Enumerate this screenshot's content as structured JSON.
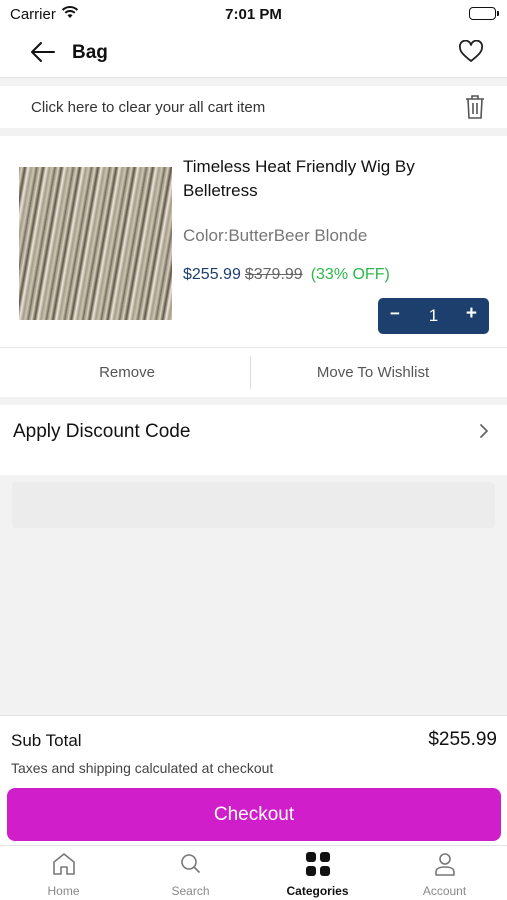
{
  "status_bar": {
    "carrier": "Carrier",
    "time": "7:01 PM"
  },
  "nav": {
    "title": "Bag",
    "back_icon": "arrow-left-icon",
    "wishlist_icon": "heart-icon"
  },
  "clear_cart": {
    "text": "Click here to clear your all cart item",
    "icon": "trash-icon"
  },
  "cart_item": {
    "name": "Timeless Heat Friendly Wig By Belletress",
    "color": "Color:ButterBeer Blonde",
    "price": "$255.99",
    "old_price": "$379.99",
    "discount": "(33% OFF)",
    "quantity": "1",
    "minus_label": "−",
    "plus_label": "+",
    "remove_label": "Remove",
    "wishlist_label": "Move To Wishlist"
  },
  "discount_code": {
    "label": "Apply Discount Code"
  },
  "summary": {
    "subtotal_label": "Sub Total",
    "subtotal_value": "$255.99",
    "tax_note": "Taxes and shipping calculated at checkout",
    "checkout_label": "Checkout"
  },
  "tabs": [
    {
      "label": "Home",
      "icon": "home-icon",
      "active": false
    },
    {
      "label": "Search",
      "icon": "search-icon",
      "active": false
    },
    {
      "label": "Categories",
      "icon": "grid-icon",
      "active": true
    },
    {
      "label": "Account",
      "icon": "user-icon",
      "active": false
    }
  ],
  "colors": {
    "brand": "#d11ecb",
    "navy": "#1d3f6e",
    "discount_green": "#2db84b"
  }
}
